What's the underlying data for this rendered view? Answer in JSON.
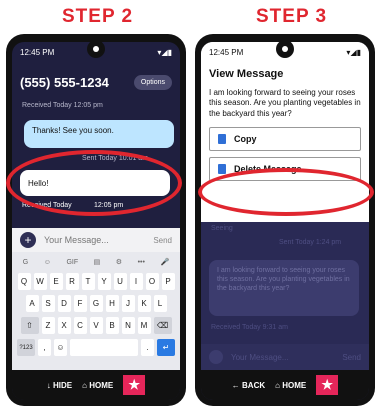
{
  "step2": {
    "title": "STEP 2",
    "status_time": "12:45 PM",
    "status_icons": "▾◢▮",
    "phone_number": "(555) 555-1234",
    "options_label": "Options",
    "top_meta": "Received Today     12:05 pm",
    "sent_bubble": "Thanks! See you soon.",
    "sent_meta": "Sent Today    10:01 am",
    "recv_bubble": "Hello!",
    "recv_meta_label": "Received Today",
    "recv_meta_time": "12:05 pm",
    "input_placeholder": "Your Message...",
    "send_label": "Send",
    "kb_tools": [
      "G",
      "☺",
      "GIF",
      "▤",
      "⚙",
      "•••",
      "🎤"
    ],
    "kb_row1": [
      "Q",
      "W",
      "E",
      "R",
      "T",
      "Y",
      "U",
      "I",
      "O",
      "P"
    ],
    "kb_row2": [
      "A",
      "S",
      "D",
      "F",
      "G",
      "H",
      "J",
      "K",
      "L"
    ],
    "kb_row3": [
      "⇧",
      "Z",
      "X",
      "C",
      "V",
      "B",
      "N",
      "M",
      "⌫"
    ],
    "kb_row4": [
      "?123",
      ",",
      "☺",
      "",
      ".",
      "↵"
    ],
    "hide_label": "↓ HIDE",
    "home_label": "⌂ HOME",
    "star": "★"
  },
  "step3": {
    "title": "STEP 3",
    "status_time": "12:45 PM",
    "status_icons": "▾◢▮",
    "dialog_title": "View Message",
    "dialog_text": "I am looking forward to seeing your roses this season. Are you planting vegetables in the backyard this year?",
    "copy_label": "Copy",
    "delete_label": "Delete Message",
    "bg_top_bubble": "Seeing",
    "bg_sent_meta": "Sent Today    1:24 pm",
    "bg_recv_bubble": "I am looking forward to seeing your roses this season. Are you planting vegetables in the backyard this year?",
    "bg_recv_meta": "Received Today    9:31 am",
    "bg_input": "Your Message...",
    "bg_send": "Send",
    "back_label": "← BACK",
    "home_label": "⌂ HOME",
    "star": "★"
  },
  "colors": {
    "accent_red": "#e0262f",
    "star_pink": "#e5265a",
    "app_bg": "#1f1f3f",
    "sent_bubble": "#bde5ff"
  }
}
